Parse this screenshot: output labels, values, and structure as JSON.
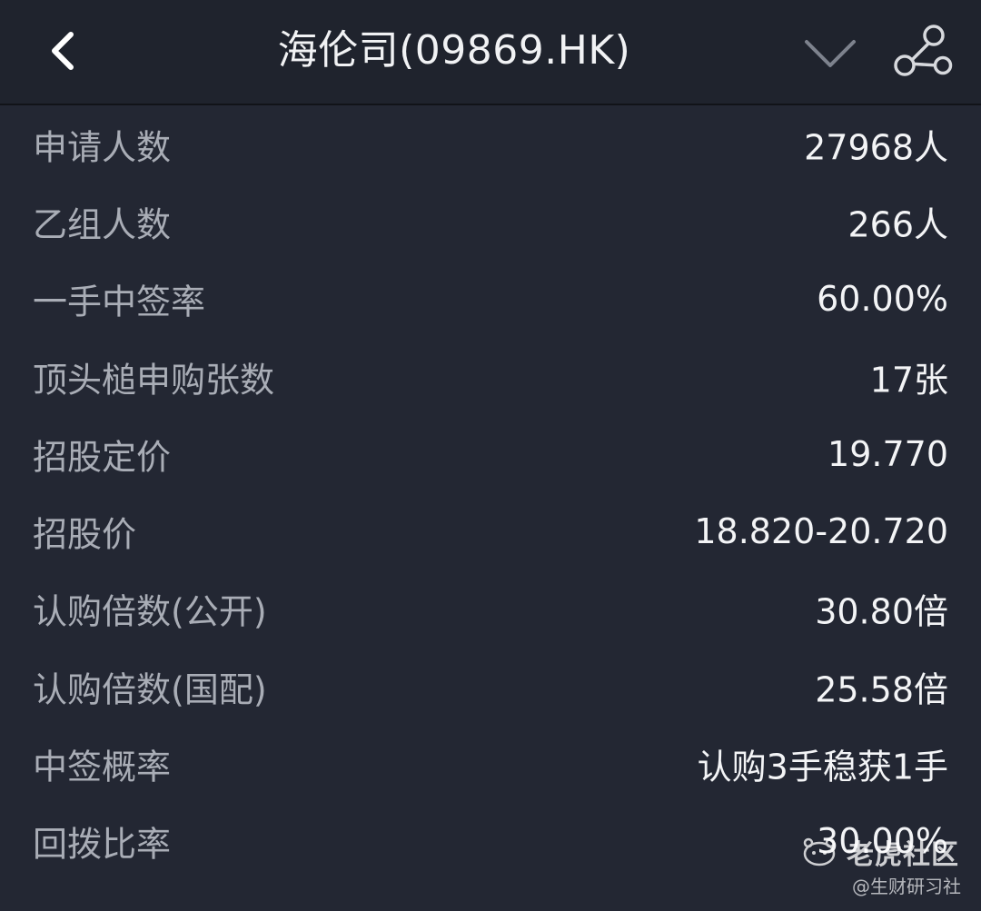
{
  "header": {
    "title": "海伦司(09869.HK)",
    "back_icon": "chevron-left-icon",
    "dropdown_icon": "chevron-down-icon",
    "share_icon": "share-nodes-icon"
  },
  "rows": [
    {
      "label": "申请人数",
      "value": "27968人"
    },
    {
      "label": "乙组人数",
      "value": "266人"
    },
    {
      "label": "一手中签率",
      "value": "60.00%"
    },
    {
      "label": "顶头槌申购张数",
      "value": "17张"
    },
    {
      "label": "招股定价",
      "value": "19.770"
    },
    {
      "label": "招股价",
      "value": "18.820-20.720"
    },
    {
      "label": "认购倍数(公开)",
      "value": "30.80倍"
    },
    {
      "label": "认购倍数(国配)",
      "value": "25.58倍"
    },
    {
      "label": "中签概率",
      "value": "认购3手稳获1手"
    },
    {
      "label": "回拨比率",
      "value": "30.00%"
    }
  ],
  "watermark": {
    "text": "老虎社区",
    "icon": "tiger-logo-icon"
  },
  "credit": "@生财研习社",
  "colors": {
    "background": "#232733",
    "header_background": "#1f232d",
    "label": "#a9adb6",
    "value": "#f3f4f6"
  }
}
